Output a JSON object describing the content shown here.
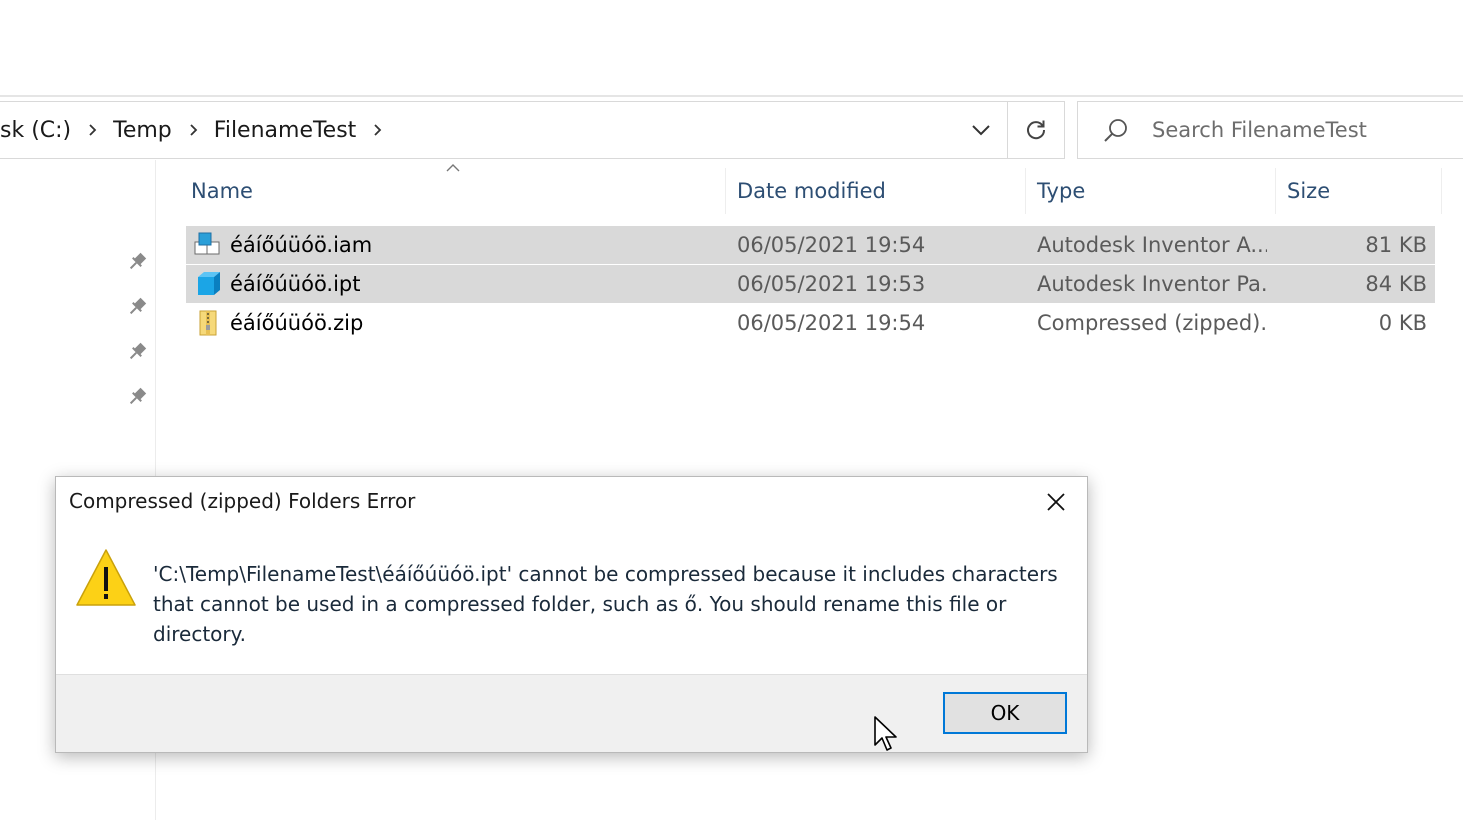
{
  "address_bar": {
    "breadcrumbs": [
      "sk (C:)",
      "Temp",
      "FilenameTest"
    ]
  },
  "search": {
    "placeholder": "Search FilenameTest"
  },
  "file_list": {
    "columns": [
      "Name",
      "Date modified",
      "Type",
      "Size"
    ],
    "rows": [
      {
        "name": "éáíőúüóö.iam",
        "date": "06/05/2021 19:54",
        "type": "Autodesk Inventor A...",
        "size": "81 KB",
        "icon": "inventor-assembly-icon",
        "selected": true
      },
      {
        "name": "éáíőúüóö.ipt",
        "date": "06/05/2021 19:53",
        "type": "Autodesk Inventor Pa...",
        "size": "84 KB",
        "icon": "inventor-part-icon",
        "selected": true
      },
      {
        "name": "éáíőúüóö.zip",
        "date": "06/05/2021 19:54",
        "type": "Compressed (zipped)...",
        "size": "0 KB",
        "icon": "zip-folder-icon",
        "selected": false
      }
    ]
  },
  "dialog": {
    "title": "Compressed (zipped) Folders Error",
    "message": "'C:\\Temp\\FilenameTest\\éáíőúüóö.ipt' cannot be compressed because it includes characters that cannot be used in a compressed folder, such as ő. You should rename this file or directory.",
    "ok_label": "OK",
    "icon": "warning-icon"
  },
  "colors": {
    "selection": "#d9d9d9",
    "header_text": "#2d4e73",
    "accent": "#0078d7",
    "warning": "#fcd116"
  }
}
